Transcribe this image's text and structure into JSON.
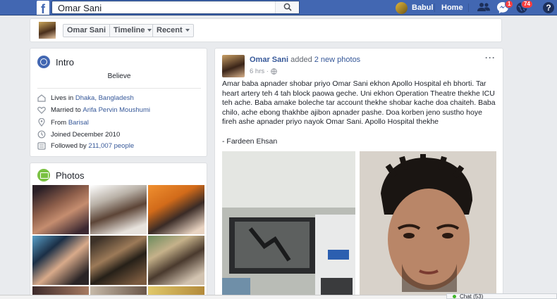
{
  "topbar": {
    "search_value": "Omar Sani",
    "user_name": "Babul",
    "home_label": "Home",
    "messages_badge": "1",
    "notifications_badge": "74",
    "help_label": "?"
  },
  "profile_nav": {
    "name": "Omar Sani",
    "timeline_label": "Timeline",
    "recent_label": "Recent"
  },
  "intro": {
    "title": "Intro",
    "bio": "Believe",
    "lives_prefix": "Lives in",
    "lives_place": "Dhaka, Bangladesh",
    "married_prefix": "Married to",
    "married_name": "Arifa Pervin Moushumi",
    "from_prefix": "From",
    "from_place": "Barisal",
    "joined": "Joined December 2010",
    "followed_prefix": "Followed by",
    "followers": "211,007 people"
  },
  "photos": {
    "title": "Photos"
  },
  "post": {
    "author": "Omar Sani",
    "action_prefix": "added",
    "action_link": "2 new photos",
    "time": "6 hrs",
    "separator": "·",
    "more_label": "···",
    "text": "Amar baba apnader shobar priyo Omar Sani ekhon Apollo Hospital eh bhorti. Tar heart artery teh 4 tah block paowa geche. Uni ekhon Operation Theatre thekhe ICU teh ache. Baba amake boleche tar account thekhe shobar kache doa chaiteh. Baba chilo, ache ebong thakhbe ajibon apnader pashe. Doa korben jeno sustho hoye fireh ashe apnader priyo nayok Omar Sani. Apollo Hospital thekhe",
    "signature": "- Fardeen Ehsan"
  },
  "chat": {
    "label": "Chat (53)"
  },
  "colors": {
    "brand_blue": "#4267b2",
    "link": "#365899",
    "badge_red": "#fa3e3e",
    "online_green": "#42b72a"
  }
}
